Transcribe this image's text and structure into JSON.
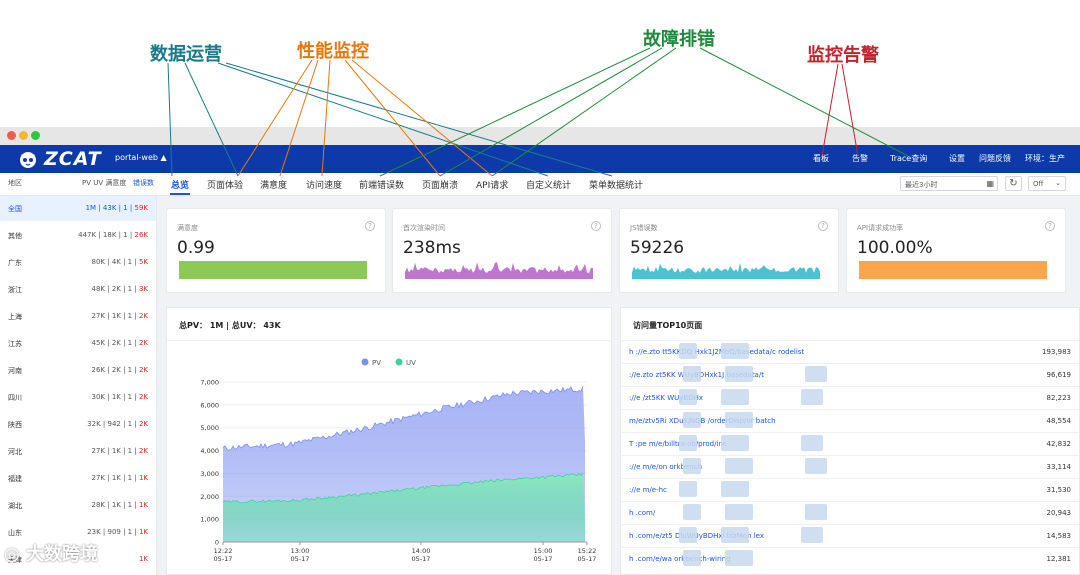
{
  "categories": [
    {
      "label": "数据运营",
      "color": "#1a7a8a"
    },
    {
      "label": "性能监控",
      "color": "#e07a10"
    },
    {
      "label": "故障排错",
      "color": "#1f8a3a"
    },
    {
      "label": "监控告警",
      "color": "#c0242c"
    }
  ],
  "brand": {
    "name": "ZCAT",
    "project": "portal-web ▲",
    "bar_color": "#0d3aa8",
    "accent": "#1a56d6"
  },
  "top_nav": [
    "看板",
    "告警",
    "Trace查询",
    "设置",
    "问题反馈",
    "环境：生产"
  ],
  "tabs": [
    "总览",
    "页面体验",
    "满意度",
    "访问速度",
    "前端错误数",
    "页面崩溃",
    "API请求",
    "自定义统计",
    "菜单数据统计"
  ],
  "region_header": {
    "region": "地区",
    "metrics": "PV  UV  满意度",
    "err": "错误数"
  },
  "filters": {
    "time_range": "最近3小时",
    "calendar_icon": "calendar-icon",
    "refresh_icon": "refresh-icon",
    "interval": "Off"
  },
  "regions": [
    {
      "name": "全国",
      "pv": "1M",
      "uv": "43K",
      "sat": "1",
      "err": "59K",
      "selected": true
    },
    {
      "name": "其他",
      "pv": "447K",
      "uv": "18K",
      "sat": "1",
      "err": "26K"
    },
    {
      "name": "广东",
      "pv": "80K",
      "uv": "4K",
      "sat": "1",
      "err": "5K"
    },
    {
      "name": "浙江",
      "pv": "48K",
      "uv": "2K",
      "sat": "1",
      "err": "3K"
    },
    {
      "name": "上海",
      "pv": "27K",
      "uv": "1K",
      "sat": "1",
      "err": "2K"
    },
    {
      "name": "江苏",
      "pv": "45K",
      "uv": "2K",
      "sat": "1",
      "err": "2K"
    },
    {
      "name": "河南",
      "pv": "26K",
      "uv": "2K",
      "sat": "1",
      "err": "2K"
    },
    {
      "name": "四川",
      "pv": "30K",
      "uv": "1K",
      "sat": "1",
      "err": "2K"
    },
    {
      "name": "陕西",
      "pv": "32K",
      "uv": "942",
      "sat": "1",
      "err": "2K"
    },
    {
      "name": "河北",
      "pv": "27K",
      "uv": "1K",
      "sat": "1",
      "err": "2K"
    },
    {
      "name": "福建",
      "pv": "27K",
      "uv": "1K",
      "sat": "1",
      "err": "1K"
    },
    {
      "name": "湖北",
      "pv": "28K",
      "uv": "1K",
      "sat": "1",
      "err": "1K"
    },
    {
      "name": "山东",
      "pv": "23K",
      "uv": "909",
      "sat": "1",
      "err": "1K"
    },
    {
      "name": "天津",
      "pv": "",
      "uv": "",
      "sat": "",
      "err": "1K"
    }
  ],
  "cards": [
    {
      "label": "满意度",
      "value": "0.99",
      "color": "#8dc955",
      "kind": "flat"
    },
    {
      "label": "首次渲染时间",
      "value": "238ms",
      "color": "#b35fc7",
      "kind": "spark"
    },
    {
      "label": "JS错误数",
      "value": "59226",
      "color": "#2ab8c9",
      "kind": "spark"
    },
    {
      "label": "API请求成功率",
      "value": "100.00%",
      "color": "#fba64c",
      "kind": "flat"
    }
  ],
  "main_chart": {
    "title": "总PV： 1M  |  总UV： 43K",
    "legend": [
      {
        "name": "PV",
        "color": "#7b8ff0"
      },
      {
        "name": "UV",
        "color": "#3ed39a"
      }
    ]
  },
  "chart_data": {
    "type": "area",
    "x": [
      "12:22",
      "13:00",
      "14:00",
      "15:00",
      "15:22"
    ],
    "x_dates": [
      "05-17",
      "05-17",
      "05-17",
      "05-17",
      "05-17"
    ],
    "yticks": [
      0,
      1000,
      2000,
      3000,
      4000,
      5000,
      6000,
      7000
    ],
    "ylim": [
      0,
      7000
    ],
    "series": [
      {
        "name": "PV",
        "values": [
          4100,
          4300,
          5000,
          5800,
          6500,
          6700
        ]
      },
      {
        "name": "UV",
        "values": [
          1750,
          1820,
          2100,
          2450,
          2750,
          2950
        ]
      }
    ]
  },
  "top10": {
    "title": "访问量TOP10页面",
    "rows": [
      {
        "url": "h      ://e.zto         tt5KKDQ          Hxk1J2MbQ/basedata/c   rodelist",
        "count": "193,983"
      },
      {
        "url": "       ://e.zto       zt5KK             WUyBDHxk1J         basedata/t",
        "count": "96,619"
      },
      {
        "url": "       ://e           /zt5KK             WUyBDHx",
        "count": "82,223"
      },
      {
        "url": "           m/e/ztv5Ri               XDuSjNGB       /orderDisp/or       batch",
        "count": "48,554"
      },
      {
        "url": "T   :pe       m/e/billtra        ob/prod/inc",
        "count": "42,832"
      },
      {
        "url": "         ://e          m/e/on                 orkbench",
        "count": "33,114"
      },
      {
        "url": "         ://e          m/e-hc",
        "count": "31,530"
      },
      {
        "url": "h                  .com/",
        "count": "20,943"
      },
      {
        "url": "h           .com/e/zt5          DluWUyBDHxl        bizMon              lex",
        "count": "14,583"
      },
      {
        "url": "h          .com/e/wa             orkbench-wiring",
        "count": "12,381"
      }
    ]
  },
  "watermark": "大数跨境"
}
